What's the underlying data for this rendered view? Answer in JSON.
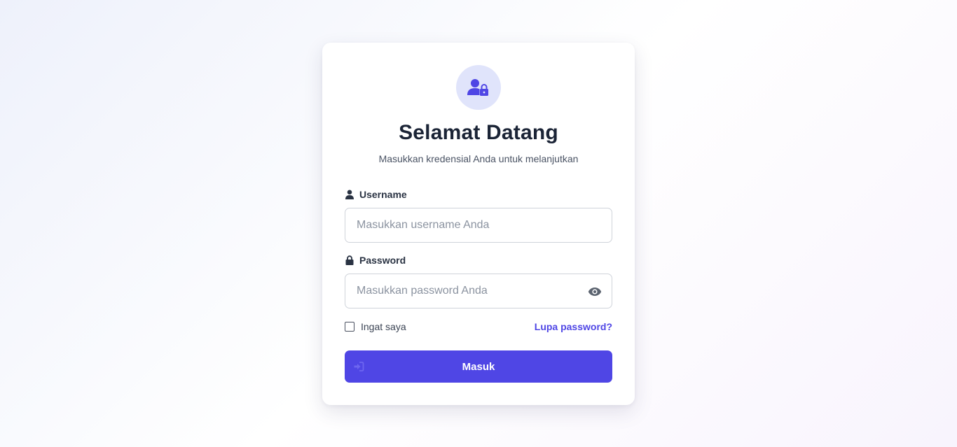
{
  "header": {
    "title": "Selamat Datang",
    "subtitle": "Masukkan kredensial Anda untuk melanjutkan",
    "avatar_icon": "user-lock-icon"
  },
  "form": {
    "username": {
      "label": "Username",
      "icon": "user-icon",
      "placeholder": "Masukkan username Anda",
      "value": ""
    },
    "password": {
      "label": "Password",
      "icon": "lock-icon",
      "placeholder": "Masukkan password Anda",
      "value": "",
      "toggle_icon": "eye-icon"
    },
    "remember_label": "Ingat saya",
    "remember_checked": false,
    "forgot_link": "Lupa password?",
    "submit_label": "Masuk",
    "submit_icon": "sign-in-icon"
  },
  "colors": {
    "accent": "#4f46e5",
    "avatar_bg": "#e0e4fb",
    "title": "#1b2436"
  }
}
